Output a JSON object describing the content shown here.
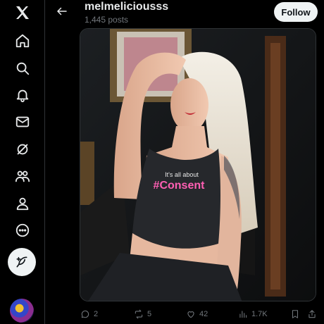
{
  "sidebar": {
    "items": [
      {
        "icon": "x-logo-icon"
      },
      {
        "icon": "home-icon"
      },
      {
        "icon": "search-icon"
      },
      {
        "icon": "notifications-icon"
      },
      {
        "icon": "messages-icon"
      },
      {
        "icon": "grok-icon"
      },
      {
        "icon": "communities-icon"
      },
      {
        "icon": "profile-icon"
      },
      {
        "icon": "more-icon"
      }
    ],
    "compose_icon": "compose-feather-icon"
  },
  "header": {
    "name": "melmeliciousss",
    "post_count": "1,445 posts",
    "follow_label": "Follow"
  },
  "media": {
    "shirt_text_small": "It's all about",
    "shirt_text_big": "#Consent"
  },
  "actions": {
    "replies": "2",
    "reposts": "5",
    "likes": "42",
    "views": "1.7K"
  },
  "colors": {
    "background": "#000000",
    "text": "#e7e9ea",
    "muted": "#71767b",
    "shirt_text": "#ff5fb3"
  }
}
